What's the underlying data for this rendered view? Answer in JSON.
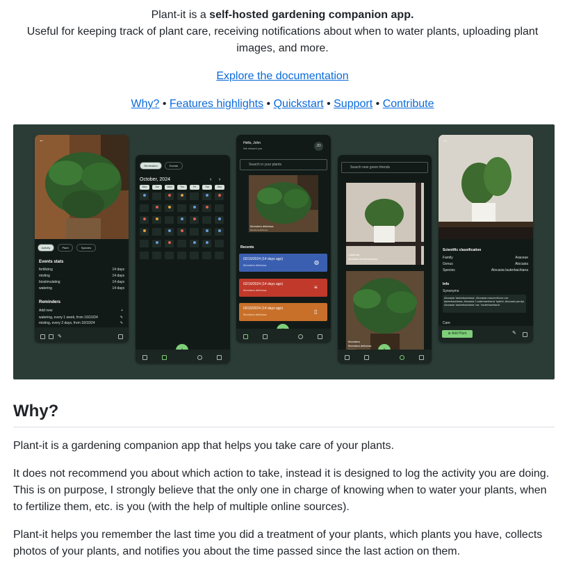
{
  "intro": {
    "prefix": "Plant-it is a ",
    "bold": "self-hosted gardening companion app.",
    "description": "Useful for keeping track of plant care, receiving notifications about when to water plants, uploading plant images, and more."
  },
  "doc_link": "Explore the documentation",
  "nav_links": [
    "Why?",
    "Features highlights",
    "Quickstart",
    "Support",
    "Contribute"
  ],
  "nav_separator": "•",
  "screens": {
    "s1": {
      "tabs": [
        "Activity",
        "Plant",
        "Species"
      ],
      "events_title": "Events stats",
      "events": [
        {
          "name": "fertilizing",
          "value": "14 days"
        },
        {
          "name": "misting",
          "value": "14 days"
        },
        {
          "name": "biostimulating",
          "value": "14 days"
        },
        {
          "name": "watering",
          "value": "14 days"
        }
      ],
      "reminders_title": "Reminders",
      "add_new": "Add new",
      "reminders": [
        "watering, every 1 week, from 16/10/24",
        "misting, every 2 days, from 16/10/24"
      ]
    },
    "s2": {
      "tabs": [
        "Reminders",
        "Events"
      ],
      "month": "October, 2024",
      "weekdays": [
        "Mon",
        "Tue",
        "Wed",
        "Thu",
        "Fri",
        "Sat",
        "Sun"
      ]
    },
    "s3": {
      "greeting": "Hello, John",
      "welcome": "We missed you",
      "avatar": "JO",
      "search_placeholder": "Search in your plants",
      "plant_name": "Monstera deliciosa",
      "plant_species": "Monstera deliciosa",
      "recents_title": "Recents",
      "events": [
        {
          "date": "02/10/2024 (14 days ago)",
          "plant": "Monstera deliciosa",
          "color": "#3b5fb0"
        },
        {
          "date": "02/10/2024 (14 days ago)",
          "plant": "Monstera deliciosa",
          "color": "#c0392b"
        },
        {
          "date": "02/10/2024 (14 days ago)",
          "plant": "Monstera deliciosa",
          "color": "#c8702a"
        }
      ]
    },
    "s4": {
      "search_placeholder": "Search new green friends",
      "cards": [
        {
          "title": "Calathea",
          "subtitle": "Alocasia lauterbachiana",
          "extra": "Alocasia"
        },
        {
          "title": "Monstera",
          "subtitle": "Monstera deliciosa",
          "extra": "Araceae"
        }
      ]
    },
    "s5": {
      "classification_title": "Scientific classification",
      "classification": [
        {
          "label": "Family",
          "value": "Araceae"
        },
        {
          "label": "Genus",
          "value": "Alocasia"
        },
        {
          "label": "Species",
          "value": "Alocasia lauterbachiana"
        }
      ],
      "info_title": "Info",
      "synonyms_label": "Synonyms",
      "synonyms": "Alocasia 'lauterbachiana', Alocasia macrorrhizos var. lauterbachiana, Alocasia 'Lauterbachiana' hybrid, Alocasia purdyi, Alocasia 'lauterbachiana' var. 'lauterbachiana'",
      "care_label": "Care",
      "add_plant": "Add Plant"
    }
  },
  "why": {
    "heading": "Why?",
    "p1": "Plant-it is a gardening companion app that helps you take care of your plants.",
    "p2": "It does not recommend you about which action to take, instead it is designed to log the activity you are doing. This is on purpose, I strongly believe that the only one in charge of knowing when to water your plants, when to fertilize them, etc. is you (with the help of multiple online sources).",
    "p3": "Plant-it helps you remember the last time you did a treatment of your plants, which plants you have, collects photos of your plants, and notifies you about the time passed since the last action on them."
  },
  "colors": {
    "link": "#0969da",
    "banner_bg": "#2b3c37",
    "accent_green": "#7fcf7a"
  }
}
